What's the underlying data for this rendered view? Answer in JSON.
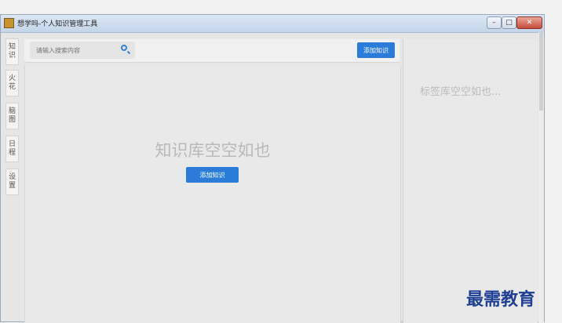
{
  "window": {
    "title": "想学吗-个人知识管理工具",
    "controls": {
      "minimize": "–",
      "maximize": "□",
      "close": "✕"
    }
  },
  "sidebar": {
    "items": [
      {
        "label": "知识"
      },
      {
        "label": "火花"
      },
      {
        "label": "脑图"
      },
      {
        "label": "日程"
      },
      {
        "label": "设置"
      }
    ]
  },
  "search": {
    "placeholder": "请输入搜索内容"
  },
  "toolbar": {
    "add_label": "添加知识"
  },
  "main": {
    "empty_text": "知识库空空如也",
    "add_label": "添加知识"
  },
  "tags": {
    "empty_text": "标签库空空如也..."
  },
  "watermark": {
    "text": "最需教育"
  }
}
